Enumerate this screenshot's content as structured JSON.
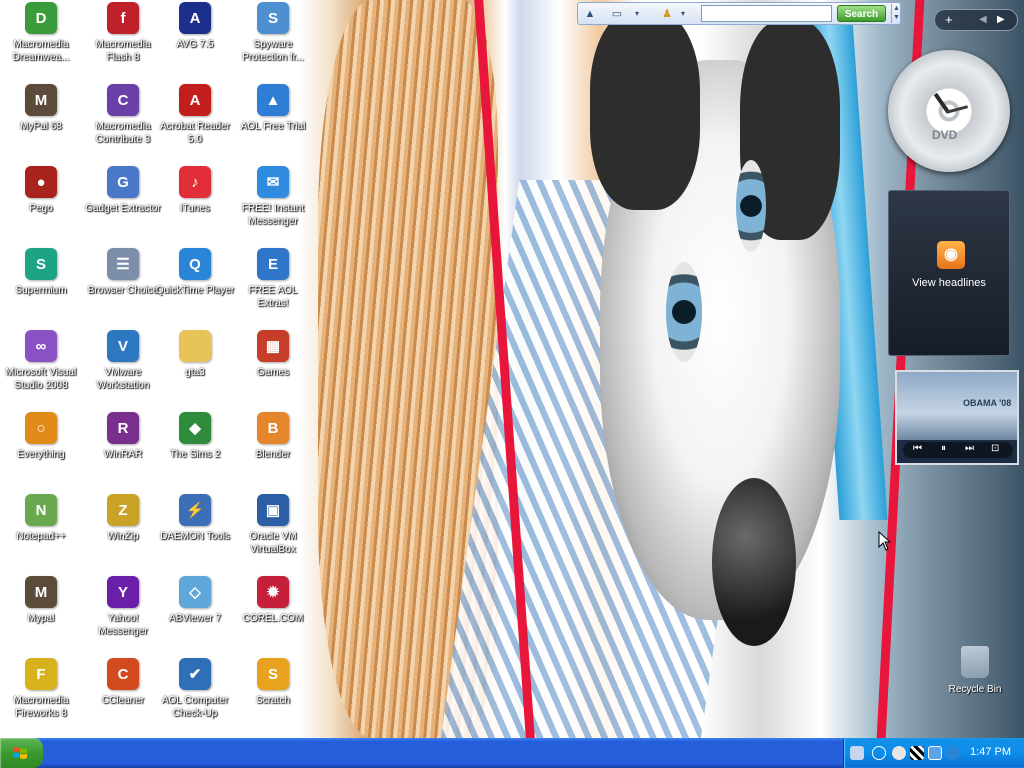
{
  "desktop_icons": [
    {
      "id": "dreamweaver",
      "label": "Macromedia Dreamwea...",
      "icon": "dreamweaver-icon",
      "color": "#3a9b3a",
      "glyph": "D"
    },
    {
      "id": "flash8",
      "label": "Macromedia Flash 8",
      "icon": "flash-icon",
      "color": "#c0202a",
      "glyph": "f"
    },
    {
      "id": "avg",
      "label": "AVG 7.5",
      "icon": "avg-icon",
      "color": "#1d2f8c",
      "glyph": "A"
    },
    {
      "id": "spyware",
      "label": "Spyware Protection fr...",
      "icon": "spyware-icon",
      "color": "#4e8fd1",
      "glyph": "S"
    },
    {
      "id": "mypal68",
      "label": "MyPal 68",
      "icon": "mypal-raccoon-icon",
      "color": "#5b4b3a",
      "glyph": "M"
    },
    {
      "id": "contribute3",
      "label": "Macromedia Contribute 3",
      "icon": "contribute-icon",
      "color": "#6b3fa8",
      "glyph": "C"
    },
    {
      "id": "acrobat",
      "label": "Acrobat Reader 5.0",
      "icon": "acrobat-icon",
      "color": "#c21e1e",
      "glyph": "A"
    },
    {
      "id": "aolfree",
      "label": "AOL Free Trial",
      "icon": "aol-icon",
      "color": "#2d7ed4",
      "glyph": "▲"
    },
    {
      "id": "pego",
      "label": "Pego",
      "icon": "pego-icon",
      "color": "#a8231c",
      "glyph": "●"
    },
    {
      "id": "gadget",
      "label": "Gadget Extractor",
      "icon": "gadget-extractor-icon",
      "color": "#4a78c9",
      "glyph": "G"
    },
    {
      "id": "itunes",
      "label": "iTunes",
      "icon": "itunes-icon",
      "color": "#e22d3b",
      "glyph": "♪"
    },
    {
      "id": "freeim",
      "label": "FREE! Instant Messenger",
      "icon": "instant-messenger-icon",
      "color": "#2f8be0",
      "glyph": "✉"
    },
    {
      "id": "supermium",
      "label": "Supermium",
      "icon": "supermium-icon",
      "color": "#1da486",
      "glyph": "S"
    },
    {
      "id": "browserchoice",
      "label": "Browser Choice",
      "icon": "browser-choice-icon",
      "color": "#7c8ea8",
      "glyph": "☰"
    },
    {
      "id": "quicktime",
      "label": "QuickTime Player",
      "icon": "quicktime-icon",
      "color": "#2a84d8",
      "glyph": "Q"
    },
    {
      "id": "aolextras",
      "label": "FREE AOL Extras!",
      "icon": "aol-extras-icon",
      "color": "#3076c8",
      "glyph": "E"
    },
    {
      "id": "vs2008",
      "label": "Microsoft Visual Studio 2008",
      "icon": "visual-studio-icon",
      "color": "#8b52c6",
      "glyph": "∞"
    },
    {
      "id": "vmware",
      "label": "VMware Workstation",
      "icon": "vmware-icon",
      "color": "#2e78c1",
      "glyph": "V"
    },
    {
      "id": "gta3",
      "label": "gta3",
      "icon": "folder-icon",
      "color": "#e7c35a",
      "glyph": ""
    },
    {
      "id": "games",
      "label": "Games",
      "icon": "games-icon",
      "color": "#c63d2a",
      "glyph": "▦"
    },
    {
      "id": "everything",
      "label": "Everything",
      "icon": "everything-search-icon",
      "color": "#e08a1a",
      "glyph": "○"
    },
    {
      "id": "winrar",
      "label": "WinRAR",
      "icon": "winrar-icon",
      "color": "#7a2f8f",
      "glyph": "R"
    },
    {
      "id": "sims2",
      "label": "The Sims 2",
      "icon": "sims-icon",
      "color": "#2f8c3d",
      "glyph": "◆"
    },
    {
      "id": "blender",
      "label": "Blender",
      "icon": "blender-icon",
      "color": "#e6862b",
      "glyph": "B"
    },
    {
      "id": "notepadpp",
      "label": "Notepad++",
      "icon": "notepadpp-icon",
      "color": "#6aa84f",
      "glyph": "N"
    },
    {
      "id": "winzip",
      "label": "WinZip",
      "icon": "winzip-icon",
      "color": "#c9a227",
      "glyph": "Z"
    },
    {
      "id": "daemon",
      "label": "DAEMON Tools",
      "icon": "daemon-tools-icon",
      "color": "#3d6fb7",
      "glyph": "⚡"
    },
    {
      "id": "virtualbox",
      "label": "Oracle VM VirtualBox",
      "icon": "virtualbox-icon",
      "color": "#2b5ea5",
      "glyph": "▣"
    },
    {
      "id": "mypal",
      "label": "Mypal",
      "icon": "mypal-raccoon-icon",
      "color": "#5b4b3a",
      "glyph": "M"
    },
    {
      "id": "yahoo",
      "label": "Yahoo! Messenger",
      "icon": "yahoo-messenger-icon",
      "color": "#6b1fa8",
      "glyph": "Y"
    },
    {
      "id": "abviewer",
      "label": "ABViewer 7",
      "icon": "abviewer-icon",
      "color": "#5ea7d8",
      "glyph": "◇"
    },
    {
      "id": "corel",
      "label": "COREL.COM",
      "icon": "corel-icon",
      "color": "#c61f3a",
      "glyph": "✹"
    },
    {
      "id": "fireworks",
      "label": "Macromedia Fireworks 8",
      "icon": "fireworks-icon",
      "color": "#d8b21c",
      "glyph": "F"
    },
    {
      "id": "ccleaner",
      "label": "CCleaner",
      "icon": "ccleaner-icon",
      "color": "#d34a1e",
      "glyph": "C"
    },
    {
      "id": "aolcheckup",
      "label": "AOL Computer Check-Up",
      "icon": "aol-checkup-icon",
      "color": "#2f6fb8",
      "glyph": "✔"
    },
    {
      "id": "scratch",
      "label": "Scratch",
      "icon": "scratch-cat-icon",
      "color": "#e8a21d",
      "glyph": "S"
    }
  ],
  "toolbar": {
    "search_placeholder": "",
    "search_button": "Search"
  },
  "gadgets": {
    "dvd_label": "DVD",
    "news_label": "View headlines",
    "slideshow_caption": "OBAMA '08"
  },
  "recycle_bin": {
    "label": "Recycle Bin"
  },
  "taskbar": {
    "clock": "1:47 PM"
  }
}
